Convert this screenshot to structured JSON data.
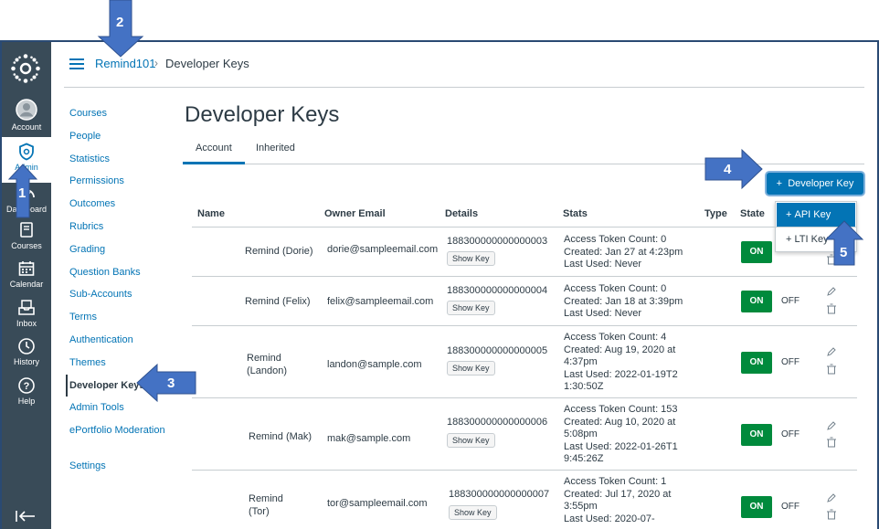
{
  "global_nav": {
    "items": [
      {
        "label": "Account",
        "icon": "account-icon"
      },
      {
        "label": "Admin",
        "icon": "admin-shield-icon"
      },
      {
        "label": "Dashboard",
        "icon": "dashboard-icon"
      },
      {
        "label": "Courses",
        "icon": "courses-book-icon"
      },
      {
        "label": "Calendar",
        "icon": "calendar-icon"
      },
      {
        "label": "Inbox",
        "icon": "inbox-icon"
      },
      {
        "label": "History",
        "icon": "history-clock-icon"
      },
      {
        "label": "Help",
        "icon": "help-icon"
      }
    ]
  },
  "header": {
    "breadcrumb_link": "Remind101",
    "breadcrumb_sep": "›",
    "breadcrumb_current": "Developer Keys"
  },
  "course_nav": {
    "items": [
      "Courses",
      "People",
      "Statistics",
      "Permissions",
      "Outcomes",
      "Rubrics",
      "Grading",
      "Question Banks",
      "Sub-Accounts",
      "Terms",
      "Authentication",
      "Themes",
      "Developer Keys",
      "Admin Tools",
      "ePortfolio Moderation",
      "Settings"
    ],
    "active": "Developer Keys"
  },
  "page": {
    "title": "Developer Keys",
    "tabs": [
      "Account",
      "Inherited"
    ],
    "active_tab": "Account",
    "add_button": "Developer Key",
    "menu": [
      "API Key",
      "LTI Key"
    ]
  },
  "table": {
    "headers": {
      "name": "Name",
      "owner_email": "Owner Email",
      "details": "Details",
      "stats": "Stats",
      "type": "Type",
      "state": "State"
    },
    "show_key_label": "Show Key",
    "on_label": "ON",
    "off_label": "OFF",
    "rows": [
      {
        "name": "Remind (Dorie)",
        "email": "dorie@sampleemail.com",
        "key": "188300000000000003",
        "stats": [
          "Access Token Count: 0",
          "Created: Jan 27 at 4:23pm",
          "Last Used: Never"
        ],
        "state": "on"
      },
      {
        "name": "Remind (Felix)",
        "email": "felix@sampleemail.com",
        "key": "188300000000000004",
        "stats": [
          "Access Token Count: 0",
          "Created: Jan 18 at 3:39pm",
          "Last Used: Never"
        ],
        "state": "on"
      },
      {
        "name": "Remind (Landon)",
        "email": "landon@sample.com",
        "key": "188300000000000005",
        "stats": [
          "Access Token Count: 4",
          "Created: Aug 19, 2020 at 4:37pm",
          "Last Used: 2022-01-19T21:30:50Z"
        ],
        "state": "on"
      },
      {
        "name": "Remind (Mak)",
        "email": "mak@sample.com",
        "key": "188300000000000006",
        "stats": [
          "Access Token Count: 153",
          "Created: Aug 10, 2020 at 5:08pm",
          "Last Used: 2022-01-26T19:45:26Z"
        ],
        "state": "on"
      },
      {
        "name": "Remind (Tor)",
        "email": "tor@sampleemail.com",
        "key": "188300000000000007",
        "stats": [
          "Access Token Count: 1",
          "Created: Jul 17, 2020 at 3:55pm",
          "Last Used: 2020-07-"
        ],
        "state": "on"
      }
    ]
  },
  "callouts": [
    "1",
    "2",
    "3",
    "4",
    "5"
  ],
  "colors": {
    "nav_bg": "#394b58",
    "link": "#0374b5",
    "toggle_on": "#008a3c",
    "callout_arrow": "#4472c4"
  }
}
